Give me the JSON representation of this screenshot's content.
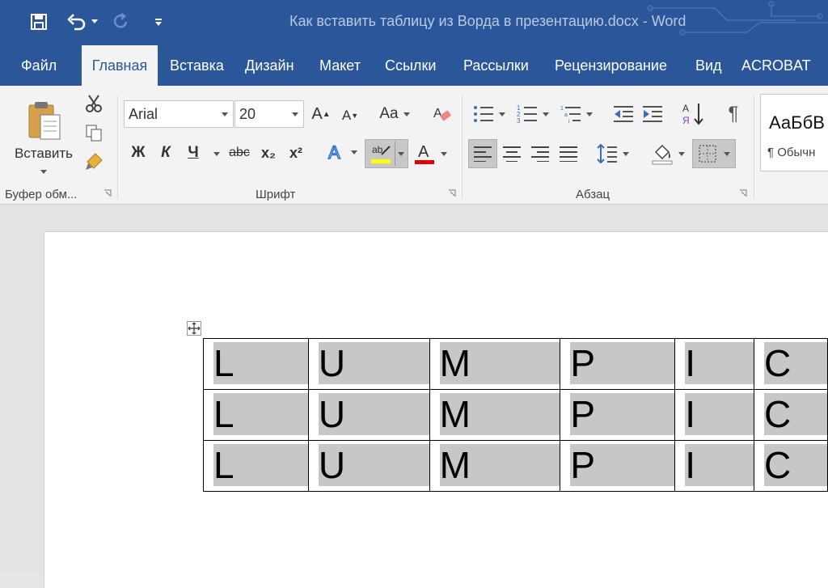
{
  "window": {
    "title": "Как вставить таблицу из Ворда в презентацию.docx - Word"
  },
  "tabs": [
    "Файл",
    "Главная",
    "Вставка",
    "Дизайн",
    "Макет",
    "Ссылки",
    "Рассылки",
    "Рецензирование",
    "Вид",
    "ACROBAT"
  ],
  "active_tab": "Главная",
  "clipboard": {
    "paste_label": "Вставить",
    "group_label": "Буфер обм..."
  },
  "font": {
    "name": "Arial",
    "size": "20",
    "case_label": "Aa",
    "group_label": "Шрифт",
    "bold": "Ж",
    "italic": "К",
    "underline": "Ч",
    "strike": "abc",
    "sub": "x₂",
    "sup": "x²"
  },
  "paragraph": {
    "group_label": "Абзац"
  },
  "styles": {
    "sample": "АаБбВ",
    "normal": "¶ Обычн"
  },
  "colors": {
    "accent": "#2b579a",
    "highlight": "#ffff00",
    "font_color": "#e00000",
    "cell_shade": "#c7c7c7"
  },
  "table": {
    "rows": [
      [
        "L",
        "U",
        "M",
        "P",
        "I",
        "C"
      ],
      [
        "L",
        "U",
        "M",
        "P",
        "I",
        "C"
      ],
      [
        "L",
        "U",
        "M",
        "P",
        "I",
        "C"
      ]
    ]
  }
}
